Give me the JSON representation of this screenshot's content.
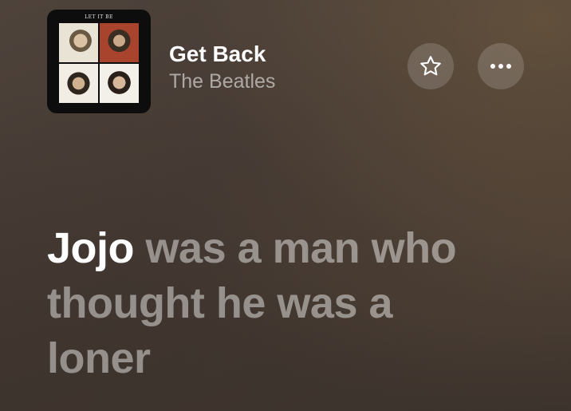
{
  "now_playing": {
    "album_art_caption": "LET IT BE",
    "title": "Get Back",
    "artist": "The Beatles",
    "favorite_icon": "star-icon",
    "more_icon": "more-options-icon"
  },
  "lyrics": {
    "line_1_active": "Jojo",
    "line_1_rest": "was a man who",
    "line_2": "thought he was a",
    "line_3": "loner"
  },
  "colors": {
    "active_word": "#ffffff",
    "upcoming_words": "#9e9590",
    "background": "#463b34"
  }
}
